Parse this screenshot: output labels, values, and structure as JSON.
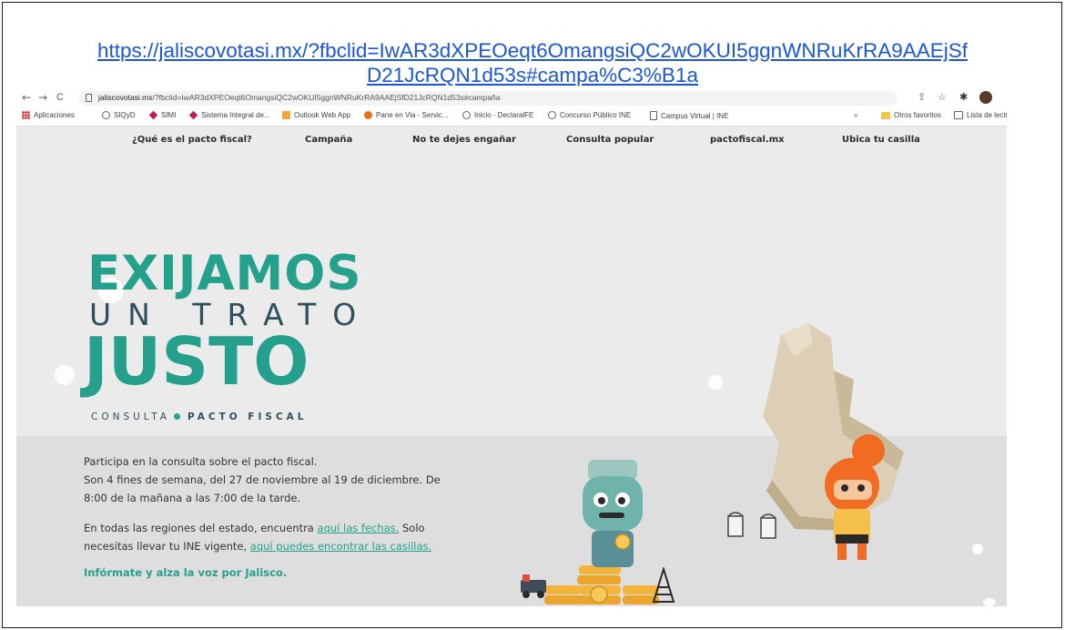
{
  "caption": {
    "link_line1": "https://jaliscovotasi.mx/?fbclid=IwAR3dXPEOeqt6OmangsiQC2wOKUI5ggnWNRuKrRA9AAEjSf",
    "link_line2": "D21JcRQN1d53s#campa%C3%B1a"
  },
  "browser": {
    "nav": {
      "back": "←",
      "forward": "→",
      "reload": "C"
    },
    "address": {
      "domain": "jaliscovotasi.mx",
      "rest": "/?fbclid=IwAR3dXPEOeqt6OmangsiQC2wOKUI5ggnWNRuKrRA9AAEjSfD21JcRQN1d53s#campaña"
    },
    "bookmarks": [
      {
        "label": "Aplicaciones",
        "icon": "apps-icon"
      },
      {
        "label": "SIQyD",
        "icon": "globe-icon"
      },
      {
        "label": "SIMI",
        "icon": "diamond-icon"
      },
      {
        "label": "Sistema Integral de...",
        "icon": "diamond-icon"
      },
      {
        "label": "Outlook Web App",
        "icon": "outlook-icon"
      },
      {
        "label": "Pane en Via - Servic...",
        "icon": "pane-icon"
      },
      {
        "label": "Inicio - DeclaralFE",
        "icon": "globe-icon"
      },
      {
        "label": "Concurso Público INE",
        "icon": "globe-icon"
      },
      {
        "label": "Campus Virtual | INE",
        "icon": "doc-icon"
      }
    ],
    "bookmarks_overflow": "»",
    "other_favorites": "Otros favoritos",
    "reading_list": "Lista de lectu"
  },
  "site": {
    "nav": [
      "¿Qué es el pacto fiscal?",
      "Campaña",
      "No te dejes engañar",
      "Consulta popular",
      "pactofiscal.mx",
      "Ubica tu casilla"
    ],
    "hero": {
      "line1": "EXIJAMOS",
      "line2": "UN TRATO",
      "line3": "JUSTO",
      "consulta": "CONSULTA",
      "pacto": "PACTO FISCAL"
    },
    "p1_l1": "Participa en la consulta sobre el pacto fiscal.",
    "p1_l2": "Son 4 fines de semana, del 27 de noviembre al 19 de diciembre. De",
    "p1_l3": "8:00 de la mañana a las 7:00 de la tarde.",
    "p2_l1_a": "En todas las regiones del estado, encuentra ",
    "p2_link1": "aquí las fechas.",
    "p2_l1_b": " Solo",
    "p2_l2_a": "necesitas llevar tu INE vigente, ",
    "p2_link2": "aquí puedes encontrar las casillas.",
    "p3": "Infórmate y alza la voz por Jalisco.",
    "colors": {
      "accent": "#25a08c",
      "dark": "#2f4f5b",
      "link": "#1a56d6"
    }
  }
}
